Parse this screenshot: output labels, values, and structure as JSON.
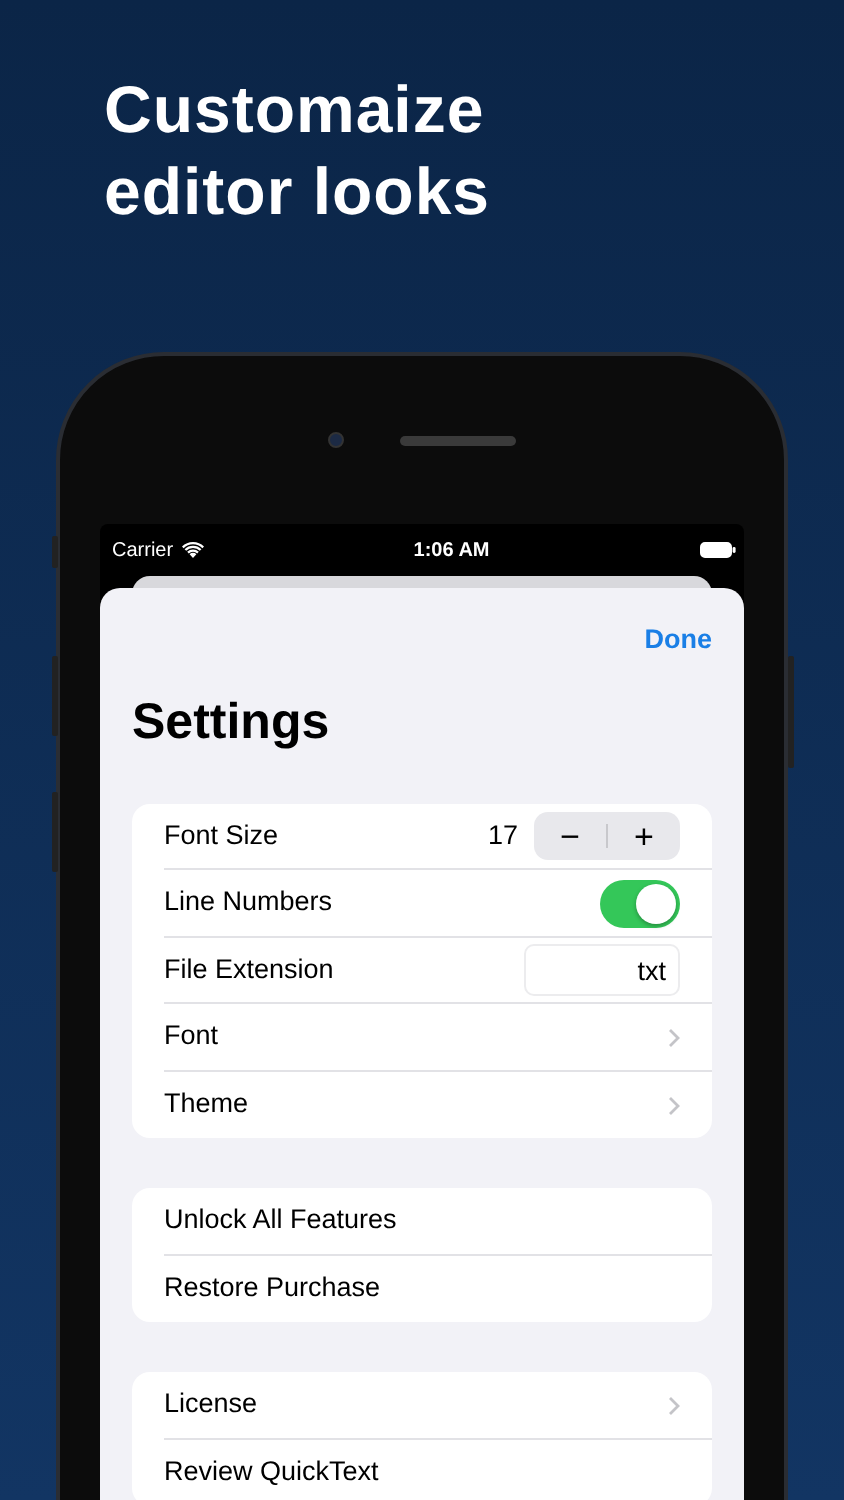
{
  "headline": [
    "Customaize",
    "editor looks"
  ],
  "status_bar": {
    "carrier": "Carrier",
    "time": "1:06 AM"
  },
  "sheet": {
    "done_button": "Done",
    "title": "Settings"
  },
  "groups": [
    {
      "rows": [
        {
          "kind": "stepper",
          "label": "Font Size",
          "value": "17",
          "minus": "−",
          "plus": "+"
        },
        {
          "kind": "toggle",
          "label": "Line Numbers",
          "on": true
        },
        {
          "kind": "field",
          "label": "File Extension",
          "value": "txt"
        },
        {
          "kind": "disclosure",
          "label": "Font"
        },
        {
          "kind": "disclosure",
          "label": "Theme"
        }
      ]
    },
    {
      "rows": [
        {
          "kind": "plain",
          "label": "Unlock All Features"
        },
        {
          "kind": "plain",
          "label": "Restore Purchase"
        }
      ]
    },
    {
      "rows": [
        {
          "kind": "disclosure",
          "label": "License"
        },
        {
          "kind": "plain",
          "label": "Review QuickText"
        }
      ]
    }
  ]
}
